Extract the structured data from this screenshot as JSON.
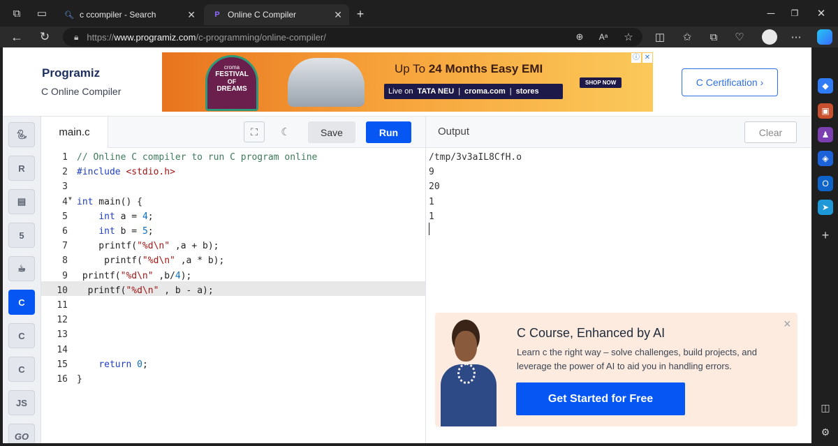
{
  "browser": {
    "tabs": [
      {
        "label": "c ccompiler - Search",
        "icon": "search-icon",
        "active": false
      },
      {
        "label": "Online C Compiler",
        "icon": "programiz-icon",
        "active": true
      }
    ],
    "url_prefix": "https://",
    "url_domain": "www.programiz.com",
    "url_path": "/c-programming/online-compiler/"
  },
  "header": {
    "logo_text": "Programiz",
    "subtitle": "C Online Compiler",
    "certification_label": "C Certification ›"
  },
  "ad": {
    "festival_brand": "croma",
    "festival_lines": [
      "FESTIVAL",
      "OF",
      "DREAMS"
    ],
    "headline_prefix": "Up To ",
    "headline_bold": "24 Months Easy EMI",
    "live_on": "Live on",
    "partner": "TATA NEU",
    "site": "croma.com",
    "stores": "stores",
    "shop_now": "SHOP NOW"
  },
  "rail": {
    "js_label": "JS",
    "go_label": "GO",
    "c_label": "C"
  },
  "editor": {
    "file_tab": "main.c",
    "save_label": "Save",
    "run_label": "Run",
    "line_numbers": [
      "1",
      "2",
      "3",
      "4",
      "5",
      "6",
      "7",
      "8",
      "9",
      "10",
      "11",
      "12",
      "13",
      "14",
      "15",
      "16"
    ],
    "lines": [
      "// Online C compiler to run C program online",
      "#include <stdio.h>",
      "",
      "int main() {",
      "    int a = 4;",
      "    int b = 5;",
      "    printf(\"%d\\n\" ,a + b);",
      "     printf(\"%d\\n\" ,a * b);",
      " printf(\"%d\\n\" ,b/4);",
      "  printf(\"%d\\n\" , b - a);",
      "",
      "",
      "",
      "",
      "    return 0;",
      "}"
    ]
  },
  "output": {
    "title": "Output",
    "clear_label": "Clear",
    "lines": [
      "/tmp/3v3aIL8CfH.o",
      "9",
      "20",
      "1",
      "1"
    ]
  },
  "promo": {
    "title": "C Course, Enhanced by AI",
    "body_line1": "Learn c the right way – solve challenges, build projects, and",
    "body_line2": "leverage the power of AI to aid you in handling errors.",
    "cta": "Get Started for Free",
    "close": "×"
  },
  "colors": {
    "accent": "#0556f3",
    "comment": "#3d7a5a",
    "keyword": "#1f3fc0",
    "string": "#a31515",
    "number": "#0e6ec0"
  }
}
